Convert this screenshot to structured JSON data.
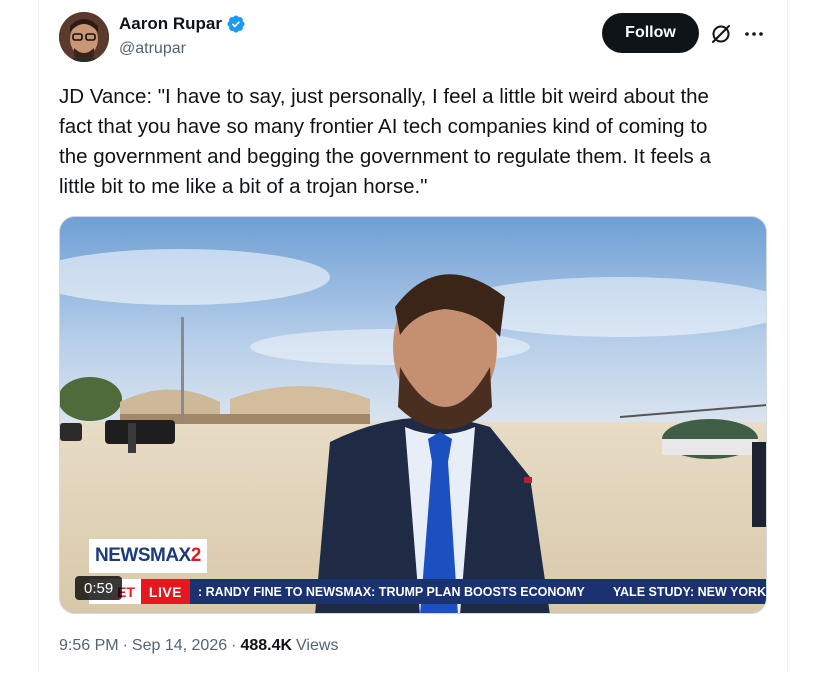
{
  "author": {
    "display_name": "Aaron Rupar",
    "handle": "@atrupar",
    "verified": true,
    "avatar_icon": "user-avatar"
  },
  "actions": {
    "follow_label": "Follow",
    "grok_icon": "grok-icon",
    "more_icon": "more-options-icon"
  },
  "tweet": {
    "text": "JD Vance: \"I have to say, just personally, I feel a little bit weird about the\nfact that you have so many frontier AI tech companies kind of coming to\nthe government and begging the government to regulate them. It feels a\nlittle bit to me like a bit of a trojan horse.\""
  },
  "media": {
    "duration": "0:59",
    "logo_main": "NEWSMAX",
    "logo_suffix": "2",
    "ticker_et": "ET",
    "ticker_live": "LIVE",
    "ticker_headline_1": ": RANDY FINE TO NEWSMAX: TRUMP PLAN BOOSTS ECONOMY",
    "ticker_headline_2": "YALE STUDY: NEW YORK TI"
  },
  "meta": {
    "time": "9:56 PM",
    "separator": "·",
    "date": "Sep 14, 2026",
    "views_count": "488.4K",
    "views_label": "Views"
  },
  "colors": {
    "accent_blue": "#1d9bf0",
    "follow_bg": "#0f1419",
    "secondary_text": "#536471",
    "newsmax_blue": "#1a3270",
    "newsmax_red": "#e5171f"
  }
}
